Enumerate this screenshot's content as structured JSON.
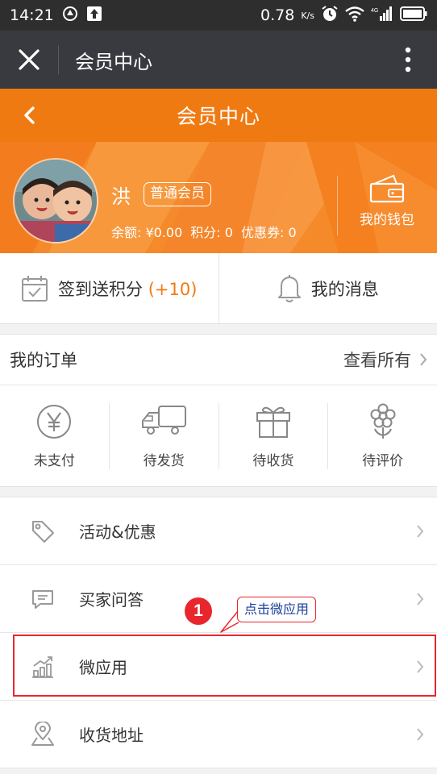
{
  "status_bar": {
    "time": "14:21",
    "network_speed": "0.78",
    "speed_unit": "K/s",
    "network_type": "4G"
  },
  "wechat_bar": {
    "title": "会员中心"
  },
  "header": {
    "title": "会员中心"
  },
  "profile": {
    "name": "洪",
    "level_badge": "普通会员",
    "balance": "余额: ¥0.00",
    "points": "积分: 0",
    "coupons": "优惠券: 0",
    "wallet_label": "我的钱包"
  },
  "quick_actions": {
    "checkin_label": "签到送积分",
    "checkin_bonus": "(+10)",
    "messages_label": "我的消息"
  },
  "orders": {
    "title": "我的订单",
    "view_all": "查看所有",
    "states": [
      {
        "label": "未支付",
        "icon": "yen-circle-icon"
      },
      {
        "label": "待发货",
        "icon": "truck-icon"
      },
      {
        "label": "待收货",
        "icon": "gift-box-icon"
      },
      {
        "label": "待评价",
        "icon": "flower-icon"
      }
    ]
  },
  "menu": [
    {
      "label": "活动&优惠",
      "icon": "tag-icon"
    },
    {
      "label": "买家问答",
      "icon": "chat-icon"
    },
    {
      "label": "微应用",
      "icon": "bar-chart-icon"
    },
    {
      "label": "收货地址",
      "icon": "location-icon"
    }
  ],
  "annotation": {
    "step_number": "1",
    "callout_text": "点击微应用",
    "color": "#e8262d"
  },
  "colors": {
    "brand_orange": "#f07a12",
    "wechat_bar": "#393a3f"
  }
}
